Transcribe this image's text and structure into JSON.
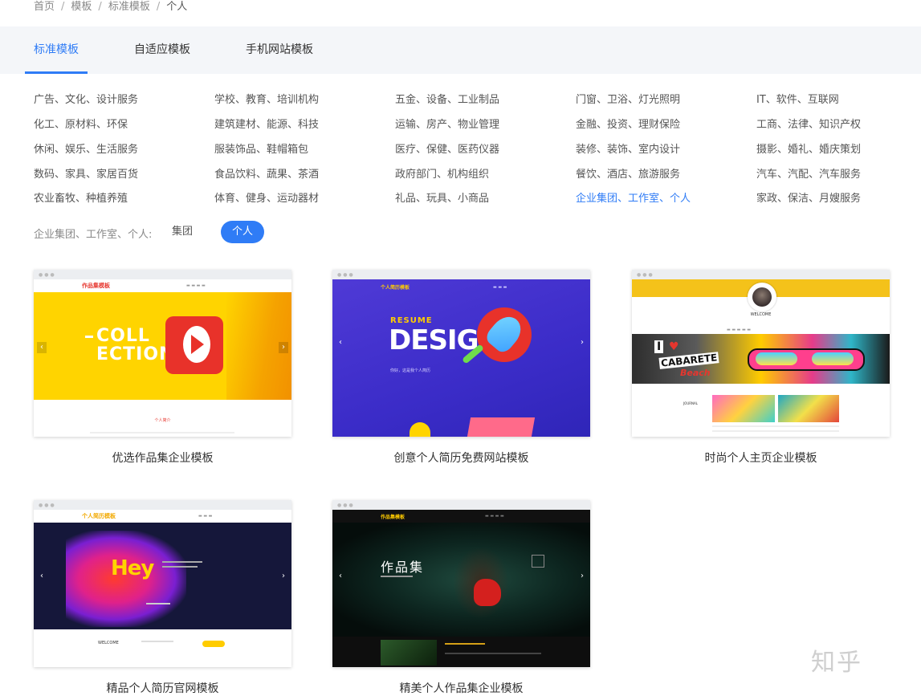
{
  "breadcrumb": {
    "home": "首页",
    "templates": "模板",
    "standard": "标准模板",
    "current": "个人",
    "sep": "/"
  },
  "tabs": {
    "standard": "标准模板",
    "responsive": "自适应模板",
    "mobile": "手机网站模板"
  },
  "categories": [
    [
      "广告、文化、设计服务",
      "学校、教育、培训机构",
      "五金、设备、工业制品",
      "门窗、卫浴、灯光照明",
      "IT、软件、互联网"
    ],
    [
      "化工、原材料、环保",
      "建筑建材、能源、科技",
      "运输、房产、物业管理",
      "金融、投资、理财保险",
      "工商、法律、知识产权"
    ],
    [
      "休闲、娱乐、生活服务",
      "服装饰品、鞋帽箱包",
      "医疗、保健、医药仪器",
      "装修、装饰、室内设计",
      "摄影、婚礼、婚庆策划"
    ],
    [
      "数码、家具、家居百货",
      "食品饮料、蔬果、茶酒",
      "政府部门、机构组织",
      "餐饮、酒店、旅游服务",
      "汽车、汽配、汽车服务"
    ],
    [
      "农业畜牧、种植养殖",
      "体育、健身、运动器材",
      "礼品、玩具、小商品",
      "企业集团、工作室、个人",
      "家政、保洁、月嫂服务"
    ]
  ],
  "filter": {
    "label": "企业集团、工作室、个人:",
    "group": "集团",
    "personal": "个人"
  },
  "cards": [
    {
      "title": "优选作品集企业模板",
      "logo": "作品集模板",
      "headline1": "COLL",
      "headline2": "ECTION",
      "section": "个人简介"
    },
    {
      "title": "创意个人简历免费网站模板",
      "logo": "个人简历模板",
      "headline1": "RESUME",
      "headline2": "DESIG",
      "sub": "你好，这是我个人简历"
    },
    {
      "title": "时尚个人主页企业模板",
      "welcome": "WELCOME",
      "art1": "I",
      "art2": "CABARETE",
      "art3": "Beach",
      "journal": "JOURNAL"
    },
    {
      "title": "精品个人简历官网模板",
      "logo": "个人简历模板",
      "headline": "Hey",
      "welcome": "WELCOME"
    },
    {
      "title": "精美个人作品集企业模板",
      "logo": "作品集模板",
      "headline": "作品集"
    }
  ],
  "watermark": "知乎"
}
